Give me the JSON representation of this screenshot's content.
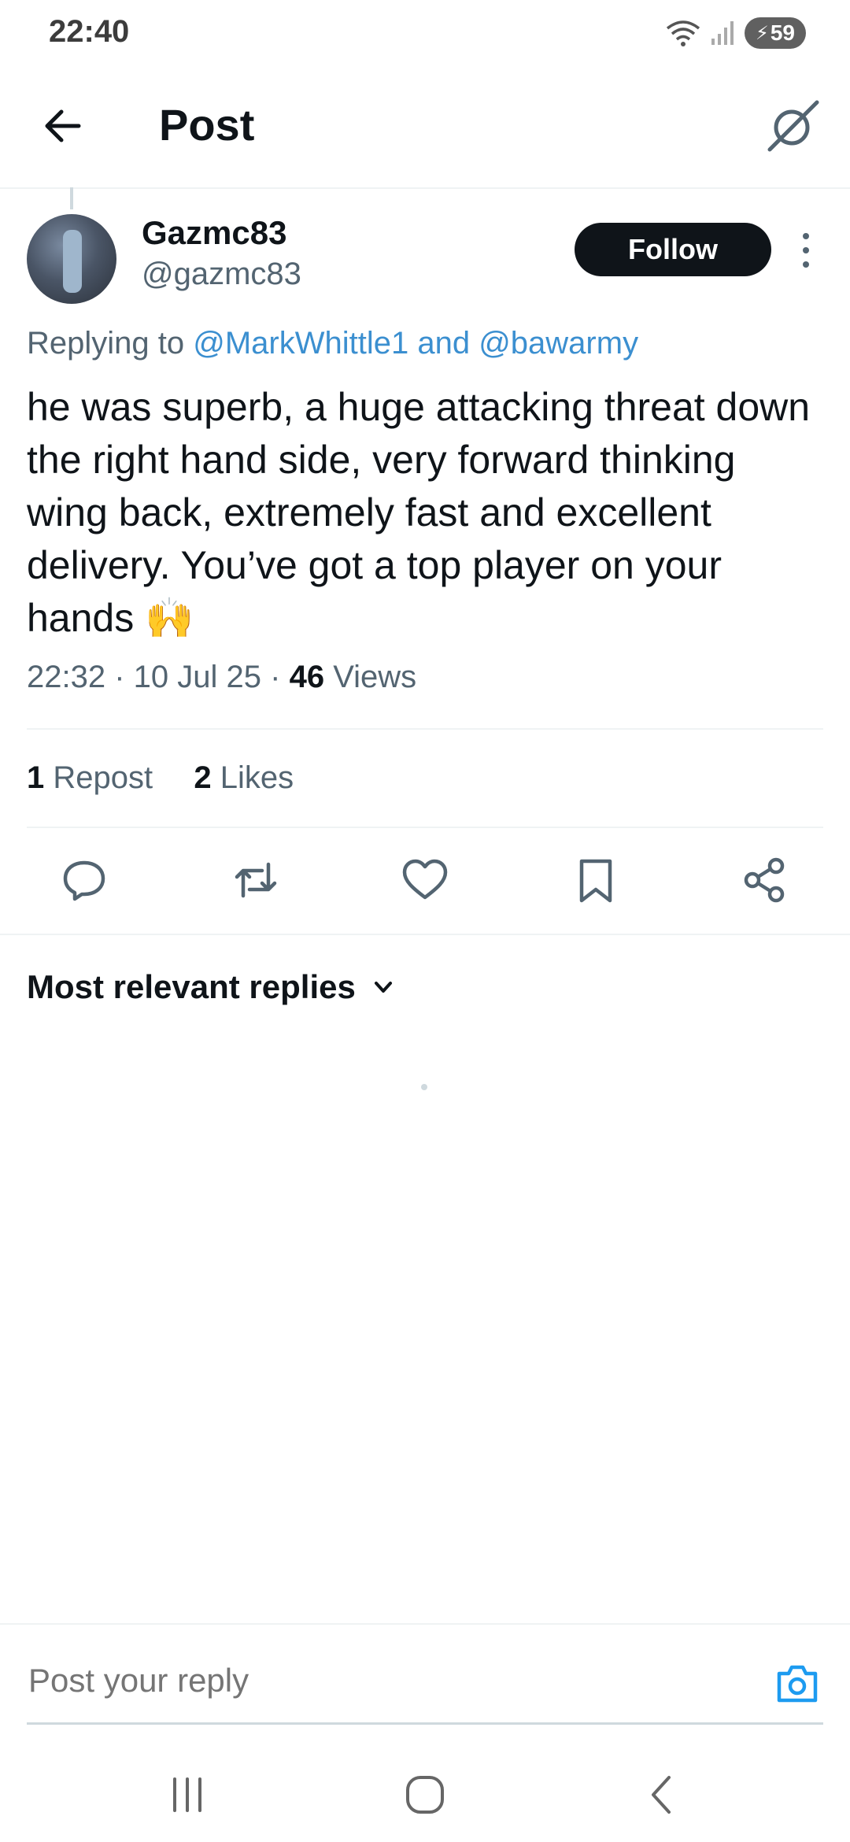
{
  "status_bar": {
    "time": "22:40",
    "battery": "59"
  },
  "header": {
    "title": "Post"
  },
  "post": {
    "author_name": "Gazmc83",
    "author_handle": "@gazmc83",
    "follow_label": "Follow",
    "replying_prefix": "Replying to",
    "replying_mentions": "@MarkWhittle1 and @bawarmy",
    "text": "he was superb, a huge attacking threat down the right hand side, very forward thinking wing back, extremely fast and excellent delivery.  You’ve got a top player on your hands 🙌",
    "time": "22:32",
    "date": "10 Jul 25",
    "views_count": "46",
    "views_label": "Views",
    "reposts_count": "1",
    "reposts_label": "Repost",
    "likes_count": "2",
    "likes_label": "Likes"
  },
  "replies": {
    "sort_label": "Most relevant replies"
  },
  "composer": {
    "placeholder": "Post your reply"
  },
  "colors": {
    "link": "#3b8fd0",
    "text": "#0f1419",
    "muted": "#536471",
    "divider": "#eff3f4"
  },
  "icons": [
    "back-arrow-icon",
    "grok-icon",
    "more-dots-icon",
    "reply-icon",
    "repost-icon",
    "like-icon",
    "bookmark-icon",
    "share-icon",
    "chevron-down-icon",
    "camera-icon"
  ]
}
